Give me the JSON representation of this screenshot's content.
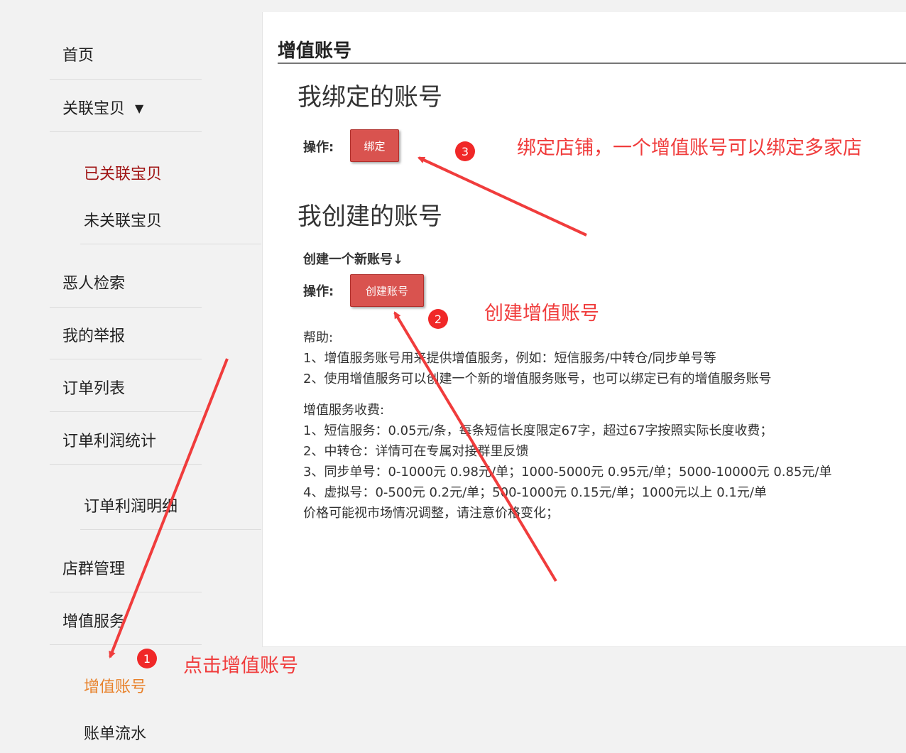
{
  "sidebar": {
    "home": "首页",
    "linked_items": "关联宝贝",
    "linked_items_caret": "▼",
    "already_linked": "已关联宝贝",
    "not_linked": "未关联宝贝",
    "bad_user_search": "恶人检索",
    "my_reports": "我的举报",
    "order_list": "订单列表",
    "order_profit_stats": "订单利润统计",
    "order_profit_detail": "订单利润明细",
    "shop_group_mgmt": "店群管理",
    "value_added_service": "增值服务",
    "value_added_account": "增值账号",
    "billing_flow": "账单流水"
  },
  "main": {
    "page_title": "增值账号",
    "bound_section_title": "我绑定的账号",
    "operation_label": "操作:",
    "bind_button": "绑定",
    "created_section_title": "我创建的账号",
    "create_hint": "创建一个新账号↓",
    "create_button": "创建账号",
    "help_title": "帮助:",
    "help_lines": [
      "1、增值服务账号用来提供增值服务，例如：短信服务/中转仓/同步单号等",
      "2、使用增值服务可以创建一个新的增值服务账号，也可以绑定已有的增值服务账号"
    ],
    "fee_title": "增值服务收费:",
    "fee_lines": [
      "1、短信服务：0.05元/条，每条短信长度限定67字，超过67字按照实际长度收费；",
      "2、中转仓：详情可在专属对接群里反馈",
      "3、同步单号：0-1000元 0.98元/单；1000-5000元 0.95元/单；5000-10000元 0.85元/单",
      "4、虚拟号：0-500元 0.2元/单；500-1000元 0.15元/单；1000元以上 0.1元/单",
      "价格可能视市场情况调整，请注意价格变化；"
    ]
  },
  "annotations": {
    "step1_badge": "1",
    "step1_text": "点击增值账号",
    "step2_badge": "2",
    "step2_text": "创建增值账号",
    "step3_badge": "3",
    "step3_text": "绑定店铺，一个增值账号可以绑定多家店",
    "color": "#f03c3c"
  }
}
